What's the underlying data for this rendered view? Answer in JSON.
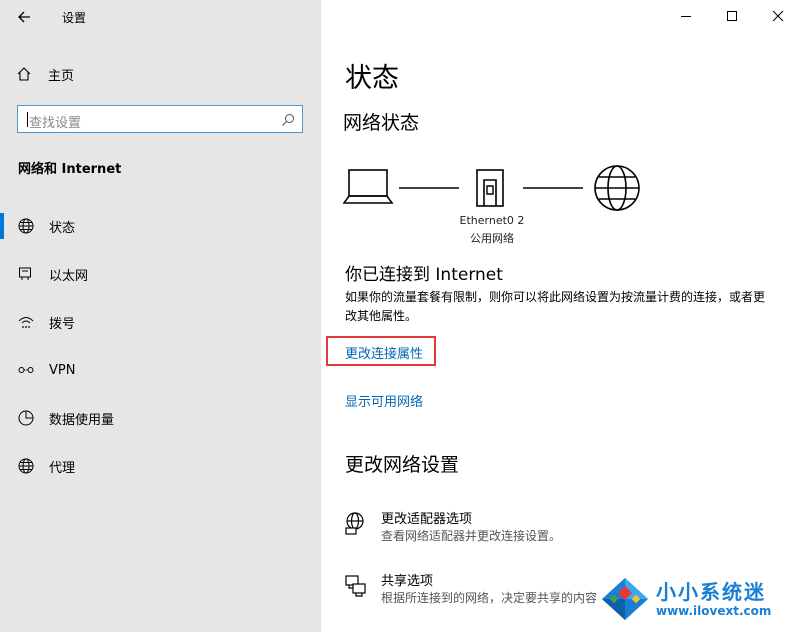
{
  "window": {
    "title": "设置",
    "controls": {
      "minimize": "minimize",
      "maximize": "maximize",
      "close": "close"
    }
  },
  "sidebar": {
    "home_label": "主页",
    "search_placeholder": "查找设置",
    "section_title": "网络和 Internet",
    "items": [
      {
        "label": "状态",
        "icon": "globe-icon",
        "selected": true
      },
      {
        "label": "以太网",
        "icon": "ethernet-icon",
        "selected": false
      },
      {
        "label": "拨号",
        "icon": "dialup-icon",
        "selected": false
      },
      {
        "label": "VPN",
        "icon": "vpn-icon",
        "selected": false
      },
      {
        "label": "数据使用量",
        "icon": "data-usage-icon",
        "selected": false
      },
      {
        "label": "代理",
        "icon": "globe-icon",
        "selected": false
      }
    ]
  },
  "main": {
    "title": "状态",
    "network_status_heading": "网络状态",
    "adapter_name": "Ethernet0 2",
    "network_type": "公用网络",
    "connected_text": "你已连接到 Internet",
    "description": "如果你的流量套餐有限制，则你可以将此网络设置为按流量计费的连接，或者更改其他属性。",
    "change_properties_link": "更改连接属性",
    "show_networks_link": "显示可用网络",
    "change_settings_heading": "更改网络设置",
    "options": [
      {
        "title": "更改适配器选项",
        "desc": "查看网络适配器并更改连接设置。",
        "icon": "adapter-icon"
      },
      {
        "title": "共享选项",
        "desc": "根据所连接到的网络，决定要共享的内容",
        "icon": "sharing-icon"
      }
    ]
  },
  "watermark": {
    "brand": "小小系统迷",
    "url": "www.ilovext.com"
  },
  "colors": {
    "accent": "#0078d7",
    "link": "#0067b8",
    "highlight": "#e03a3a",
    "sidebar_bg": "#e6e6e6"
  }
}
